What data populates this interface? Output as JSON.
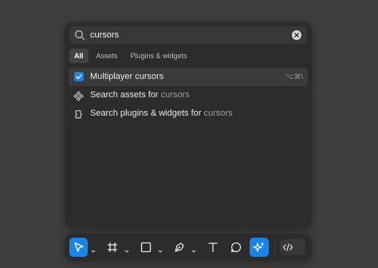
{
  "search": {
    "value": "cursors",
    "icon": "search-icon",
    "clear_icon": "clear-icon"
  },
  "filters": [
    {
      "label": "All",
      "active": true
    },
    {
      "label": "Assets",
      "active": false
    },
    {
      "label": "Plugins & widgets",
      "active": false
    }
  ],
  "results": {
    "multiplayer": {
      "label": "Multiplayer cursors",
      "shortcut": "⌥⌘\\",
      "checked": true
    },
    "assets": {
      "prefix": "Search assets for",
      "query": "cursors"
    },
    "plugins": {
      "prefix": "Search plugins & widgets for",
      "query": "cursors"
    }
  },
  "toolbar": {
    "tools": [
      "move-tool",
      "frame-tool",
      "shape-tool",
      "pen-tool",
      "text-tool",
      "comment-tool",
      "actions-tool"
    ],
    "active_tool": "actions-tool",
    "dev_mode_icon": "code-icon"
  },
  "colors": {
    "accent": "#1b84e8",
    "panel": "#2c2c2c",
    "background": "#3e3e3e"
  }
}
